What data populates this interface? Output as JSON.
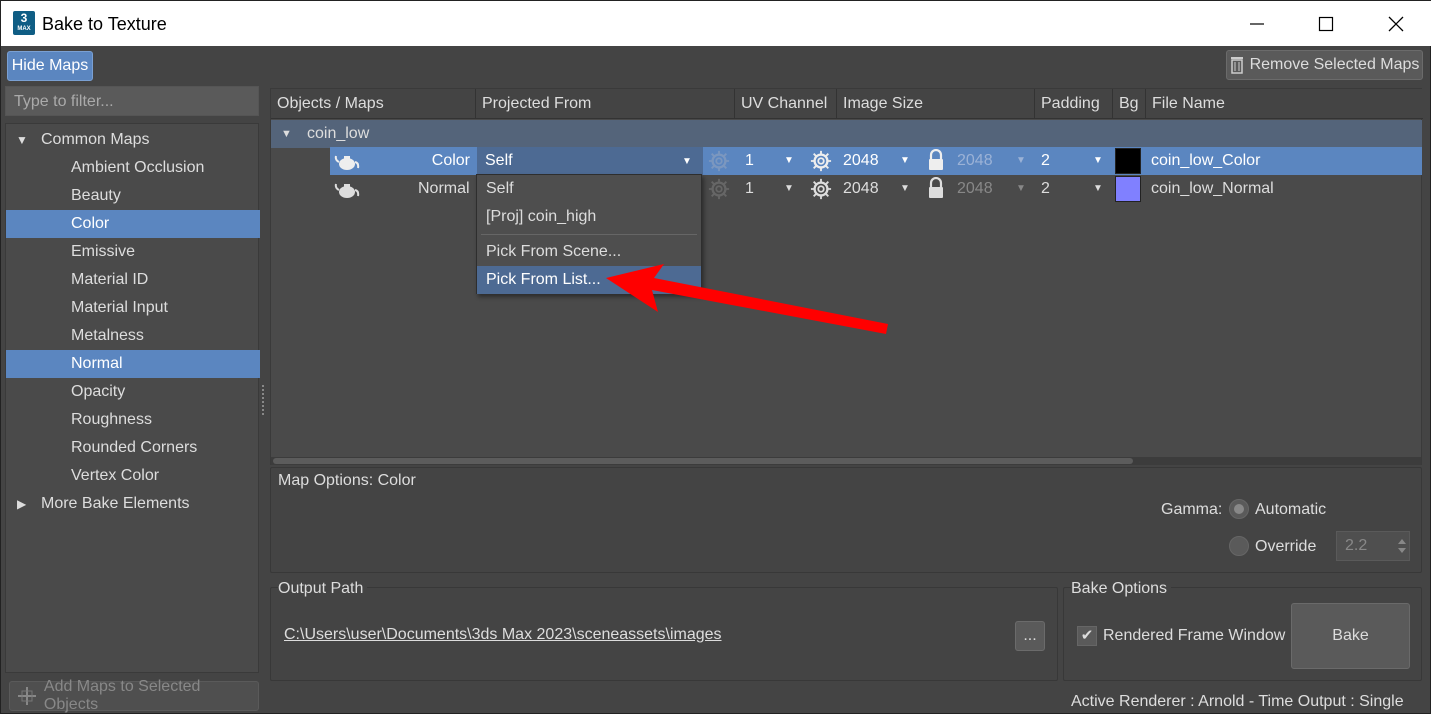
{
  "window": {
    "title": "Bake to Texture",
    "logo_text": "3",
    "logo_sub": "MAX"
  },
  "toolbar": {
    "hide_maps": "Hide Maps",
    "remove_selected": "Remove Selected Maps"
  },
  "sidebar": {
    "filter_placeholder": "Type to filter...",
    "common_maps": "Common Maps",
    "items": [
      "Ambient Occlusion",
      "Beauty",
      "Color",
      "Emissive",
      "Material ID",
      "Material Input",
      "Metalness",
      "Normal",
      "Opacity",
      "Roughness",
      "Rounded Corners",
      "Vertex Color"
    ],
    "more": "More Bake Elements",
    "add_button": "Add Maps to Selected Objects"
  },
  "grid": {
    "headers": [
      "Objects / Maps",
      "Projected From",
      "UV Channel",
      "Image Size",
      "Padding",
      "Bg",
      "File Name"
    ],
    "object": "coin_low",
    "rows": [
      {
        "map": "Color",
        "projected": "Self",
        "uv": "1",
        "size": "2048",
        "locked_size": "2048",
        "padding": "2",
        "bg": "#000000",
        "file": "coin_low_Color"
      },
      {
        "map": "Normal",
        "projected": "",
        "uv": "1",
        "size": "2048",
        "locked_size": "2048",
        "padding": "2",
        "bg": "#8080ff",
        "file": "coin_low_Normal"
      }
    ]
  },
  "dropdown": {
    "items": [
      "Self",
      "[Proj] coin_high",
      "Pick From Scene...",
      "Pick From List..."
    ]
  },
  "map_options": {
    "title": "Map Options: Color",
    "gamma_label": "Gamma:",
    "automatic": "Automatic",
    "override": "Override",
    "override_value": "2.2"
  },
  "output": {
    "title": "Output Path",
    "path": "C:\\Users\\user\\Documents\\3ds Max 2023\\sceneassets\\images",
    "browse": "..."
  },
  "bake_options": {
    "title": "Bake Options",
    "rendered_frame": "Rendered Frame Window",
    "bake_button": "Bake",
    "checkmark": "✔"
  },
  "status": "Active Renderer : Arnold  -  Time Output : Single",
  "colors": {
    "accent": "#5b86c0",
    "arrow": "#ff0000"
  }
}
